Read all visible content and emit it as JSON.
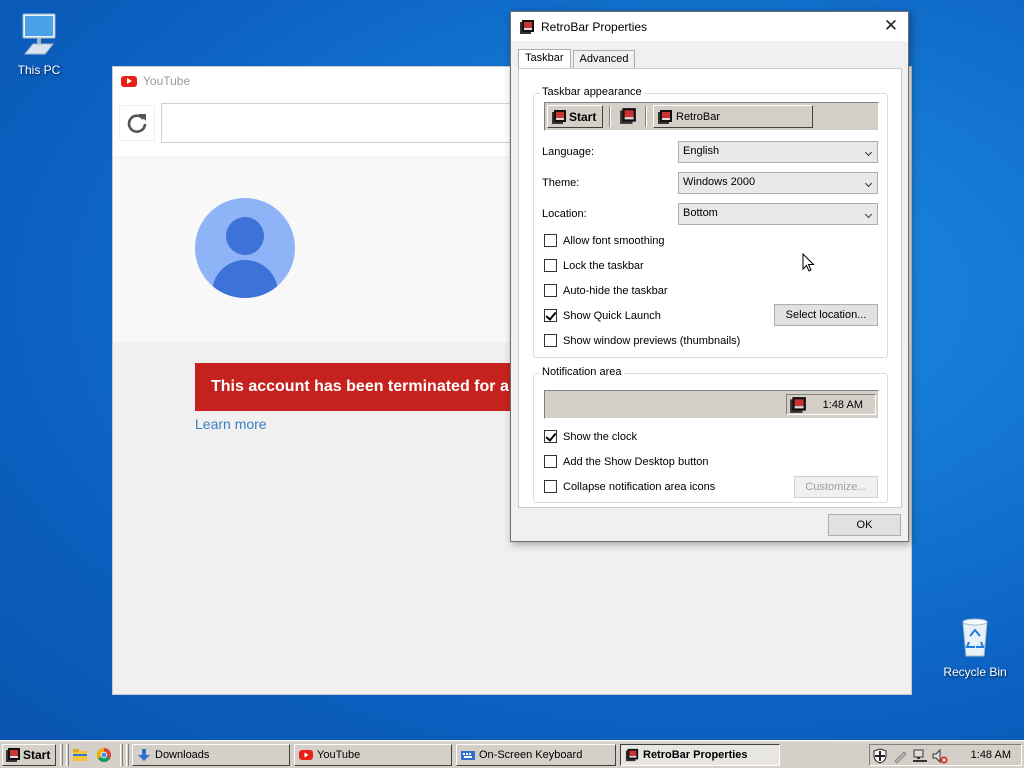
{
  "desktop": {
    "icons": [
      {
        "label": "This PC",
        "icon": "computer-icon"
      },
      {
        "label": "Recycle Bin",
        "icon": "recycle-bin-icon"
      }
    ]
  },
  "youtube_window": {
    "title": "YouTube",
    "url": "",
    "banner_text": "This account has been terminated for a vi",
    "learn_more": "Learn more"
  },
  "dialog": {
    "title": "RetroBar Properties",
    "close_glyph": "✕",
    "tabs": [
      "Taskbar",
      "Advanced"
    ],
    "taskbar_appearance": {
      "label": "Taskbar appearance",
      "preview_start": "Start",
      "preview_task": "RetroBar",
      "language_label": "Language:",
      "language_value": "English",
      "theme_label": "Theme:",
      "theme_value": "Windows 2000",
      "location_label": "Location:",
      "location_value": "Bottom",
      "options": [
        {
          "label": "Allow font smoothing",
          "checked": false
        },
        {
          "label": "Lock the taskbar",
          "checked": false
        },
        {
          "label": "Auto-hide the taskbar",
          "checked": false
        },
        {
          "label": "Show Quick Launch",
          "checked": true
        },
        {
          "label": "Show window previews (thumbnails)",
          "checked": false
        }
      ],
      "select_location_button": "Select location..."
    },
    "notification_area": {
      "label": "Notification area",
      "preview_clock": "1:48 AM",
      "options": [
        {
          "label": "Show the clock",
          "checked": true
        },
        {
          "label": "Add the Show Desktop button",
          "checked": false
        },
        {
          "label": "Collapse notification area icons",
          "checked": false
        }
      ],
      "customize_button": "Customize..."
    },
    "ok_button": "OK"
  },
  "taskbar": {
    "start_label": "Start",
    "buttons": [
      {
        "label": "Downloads",
        "icon": "download-arrow-icon"
      },
      {
        "label": "YouTube",
        "icon": "youtube-icon"
      },
      {
        "label": "On-Screen Keyboard",
        "icon": "keyboard-icon"
      },
      {
        "label": "RetroBar Properties",
        "icon": "retrobar-icon",
        "active": true
      }
    ],
    "clock": "1:48 AM"
  },
  "colors": {
    "desktop_blue": "#1477d2",
    "banner_red": "#c5221f",
    "link_blue": "#3b7fc4",
    "avatar_light": "#8eb4f7",
    "avatar_dark": "#3d72d9",
    "classic_face": "#d4d0c8"
  }
}
